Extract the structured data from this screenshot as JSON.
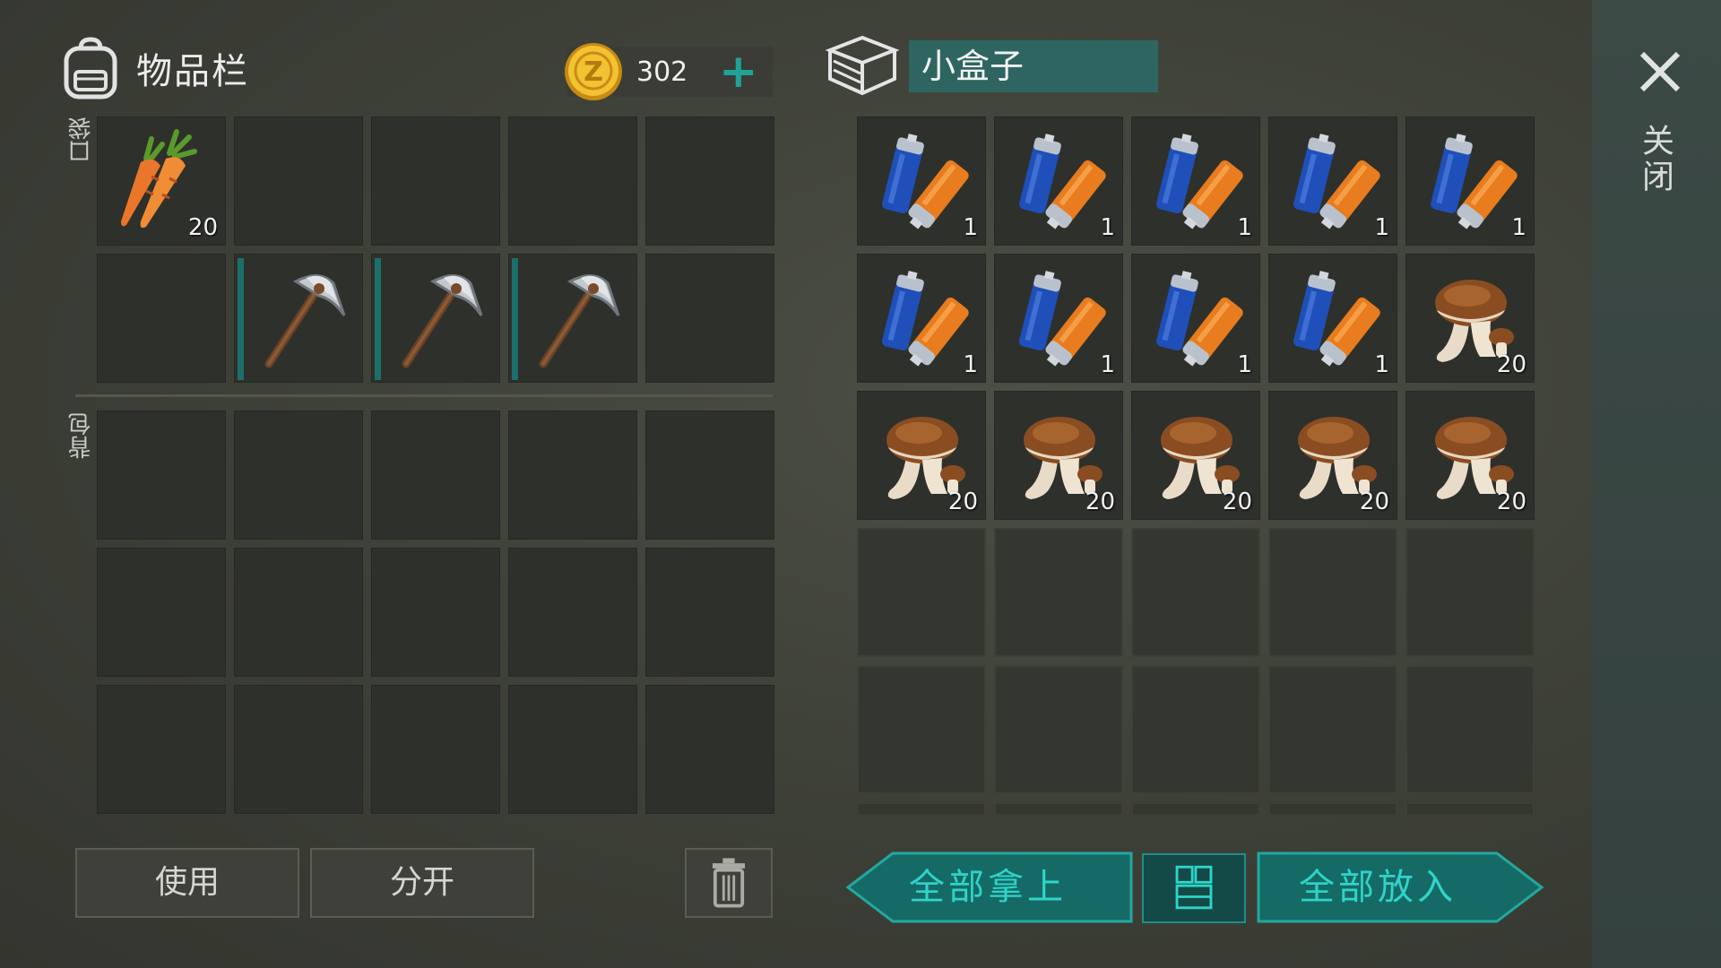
{
  "inventory": {
    "title": "物品栏",
    "coins": "302",
    "plus": "+",
    "pocket_label": "口袋",
    "backpack_label": "背包",
    "pocket_slots": [
      {
        "item": "carrot",
        "qty": "20",
        "marked": false
      },
      {
        "item": "",
        "qty": "",
        "marked": false
      },
      {
        "item": "",
        "qty": "",
        "marked": false
      },
      {
        "item": "",
        "qty": "",
        "marked": false
      },
      {
        "item": "",
        "qty": "",
        "marked": false
      },
      {
        "item": "",
        "qty": "",
        "marked": false
      },
      {
        "item": "pickaxe",
        "qty": "",
        "marked": true
      },
      {
        "item": "pickaxe",
        "qty": "",
        "marked": true
      },
      {
        "item": "pickaxe",
        "qty": "",
        "marked": true
      },
      {
        "item": "",
        "qty": "",
        "marked": false
      }
    ],
    "backpack_slots": 15
  },
  "container": {
    "name": "小盒子",
    "slots": [
      {
        "item": "battery",
        "qty": "1"
      },
      {
        "item": "battery",
        "qty": "1"
      },
      {
        "item": "battery",
        "qty": "1"
      },
      {
        "item": "battery",
        "qty": "1"
      },
      {
        "item": "battery",
        "qty": "1"
      },
      {
        "item": "battery",
        "qty": "1"
      },
      {
        "item": "battery",
        "qty": "1"
      },
      {
        "item": "battery",
        "qty": "1"
      },
      {
        "item": "battery",
        "qty": "1"
      },
      {
        "item": "mushroom",
        "qty": "20"
      },
      {
        "item": "mushroom",
        "qty": "20"
      },
      {
        "item": "mushroom",
        "qty": "20"
      },
      {
        "item": "mushroom",
        "qty": "20"
      },
      {
        "item": "mushroom",
        "qty": "20"
      },
      {
        "item": "mushroom",
        "qty": "20"
      }
    ],
    "empty_slots": 15
  },
  "close_label": "关闭",
  "buttons": {
    "use": "使用",
    "split": "分开",
    "take_all": "全部拿上",
    "put_all": "全部放入"
  },
  "icons": {
    "backpack": "backpack-icon",
    "coin": "coin-icon",
    "box": "box-icon",
    "close": "close-icon",
    "trash": "trash-icon",
    "layout": "layout-icon"
  },
  "colors": {
    "accent_teal": "#1fa398",
    "teal_text": "#2fd4c8",
    "box_name_bg": "#2e6560",
    "slot_bg": "#2e302b"
  }
}
